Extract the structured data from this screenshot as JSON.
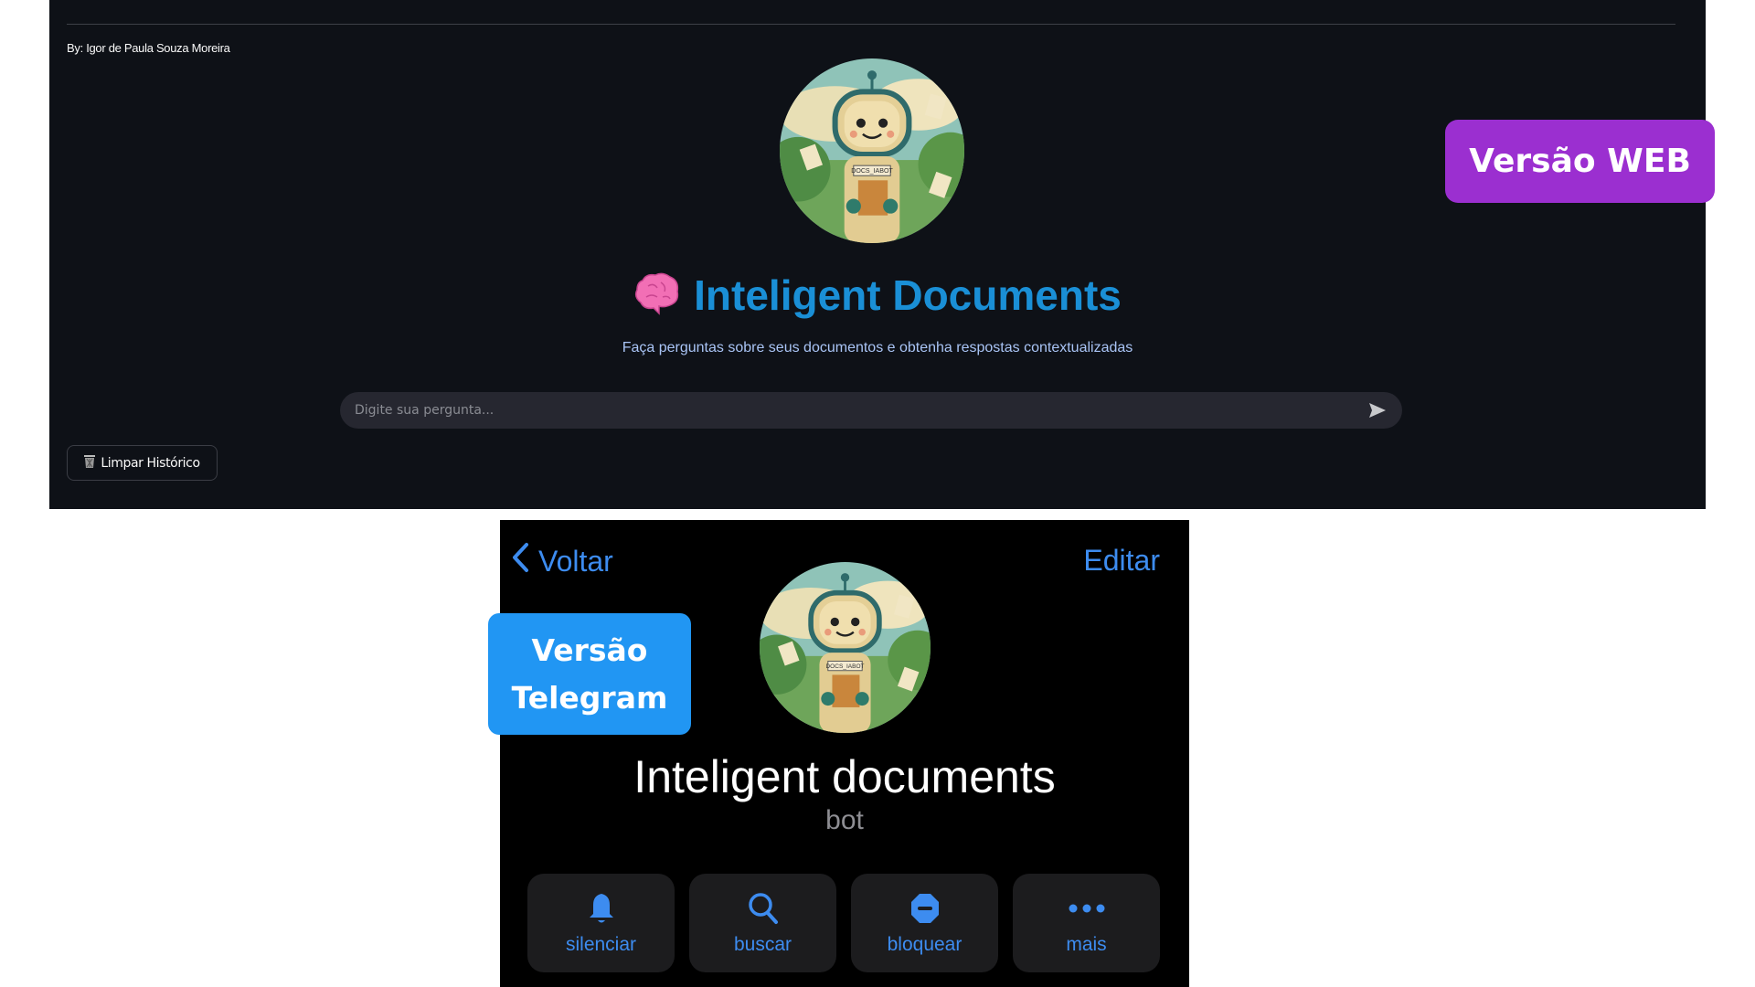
{
  "web": {
    "byline": "By: Igor de Paula Souza Moreira",
    "title": "Inteligent Documents",
    "subtitle": "Faça perguntas sobre seus documentos e obtenha respostas contextualizadas",
    "input_placeholder": "Digite sua pergunta...",
    "clear_button": "Limpar Histórico",
    "avatar_label": "DOCS_IABOT",
    "title_color": "#1a8fd6"
  },
  "badges": {
    "web": "Versão WEB",
    "telegram_line1": "Versão",
    "telegram_line2": "Telegram",
    "web_color": "#9b2fd0",
    "telegram_color": "#2196f3"
  },
  "telegram": {
    "back": "Voltar",
    "edit": "Editar",
    "name": "Inteligent documents",
    "subtitle": "bot",
    "avatar_label": "DOCS_IABOT",
    "actions": [
      {
        "label": "silenciar",
        "icon": "bell-icon"
      },
      {
        "label": "buscar",
        "icon": "search-icon"
      },
      {
        "label": "bloquear",
        "icon": "block-icon"
      },
      {
        "label": "mais",
        "icon": "more-icon"
      }
    ],
    "accent": "#3d8cf0"
  }
}
